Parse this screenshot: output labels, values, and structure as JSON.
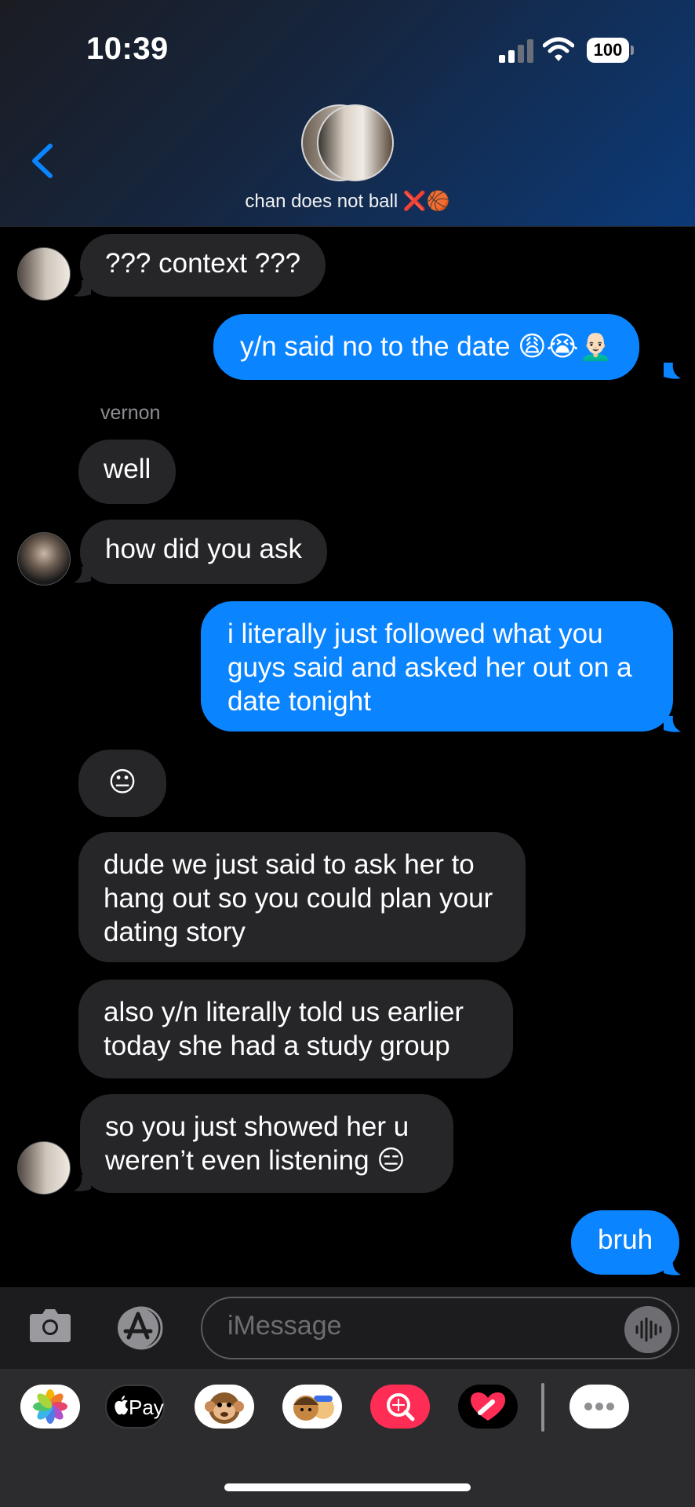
{
  "status_bar": {
    "time": "10:39",
    "battery": "100"
  },
  "chat": {
    "name": "chan does not ball ❌🏀"
  },
  "messages": [
    {
      "text": "??? context ???"
    },
    {
      "text": "y/n said no to the date 😩😭👨🏻‍🦲"
    },
    {
      "sender": "vernon"
    },
    {
      "text": "well"
    },
    {
      "text": "how did you ask"
    },
    {
      "text": "i literally just followed what you guys said and asked her out on a date tonight"
    },
    {
      "text": "😐"
    },
    {
      "text": "dude we just said to ask her to hang out so you could plan your dating story"
    },
    {
      "text": "also y/n literally told us earlier today she had a study group"
    },
    {
      "text": "so you just showed her u weren’t even listening 😑"
    },
    {
      "text": "bruh"
    }
  ],
  "input": {
    "placeholder": "iMessage"
  },
  "apps": [
    {
      "icon": "photos-icon"
    },
    {
      "label": "Pay",
      "icon": "apple-pay-icon"
    },
    {
      "icon": "animoji-icon"
    },
    {
      "icon": "memoji-icon"
    },
    {
      "icon": "image-search-icon"
    },
    {
      "icon": "digital-touch-icon"
    },
    {
      "icon": "more-apps-icon"
    }
  ],
  "colors": {
    "outgoing": "#0a84ff",
    "incoming": "#262629",
    "accent": "#0a84ff",
    "background": "#000000"
  }
}
